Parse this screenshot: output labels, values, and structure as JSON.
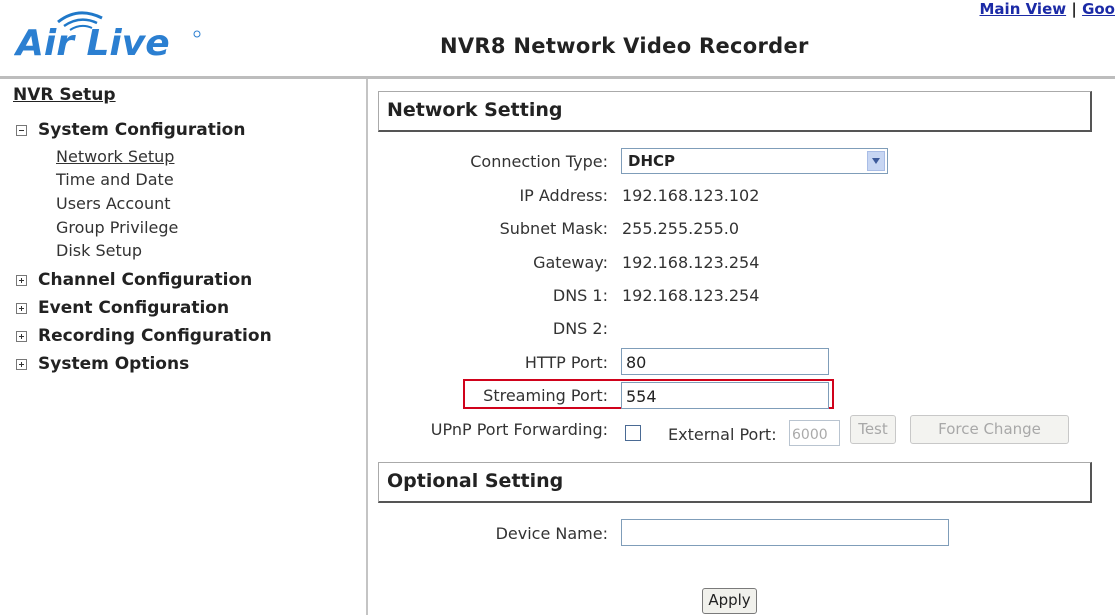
{
  "header": {
    "logo_text": "Air Live",
    "app_title": "NVR8 Network Video Recorder",
    "links": {
      "main_view": "Main View",
      "separator": "|",
      "partial": "Goo"
    }
  },
  "sidebar": {
    "title": "NVR Setup",
    "system_configuration": {
      "label": "System Configuration",
      "items": [
        "Network Setup",
        "Time and Date",
        "Users Account",
        "Group Privilege",
        "Disk Setup"
      ]
    },
    "sections": [
      "Channel Configuration",
      "Event Configuration",
      "Recording Configuration",
      "System Options"
    ]
  },
  "network": {
    "title": "Network Setting",
    "connection_type_label": "Connection Type:",
    "connection_type_value": "DHCP",
    "ip_label": "IP Address:",
    "ip_value": "192.168.123.102",
    "subnet_label": "Subnet Mask:",
    "subnet_value": "255.255.255.0",
    "gateway_label": "Gateway:",
    "gateway_value": "192.168.123.254",
    "dns1_label": "DNS 1:",
    "dns1_value": "192.168.123.254",
    "dns2_label": "DNS 2:",
    "dns2_value": "",
    "http_port_label": "HTTP Port:",
    "http_port_value": "80",
    "streaming_port_label": "Streaming Port:",
    "streaming_port_value": "554",
    "upnp_label": "UPnP Port Forwarding:",
    "upnp_checked": false,
    "external_port_label": "External Port:",
    "external_port_value": "6000",
    "test_label": "Test",
    "force_change_label": "Force Change"
  },
  "optional": {
    "title": "Optional Setting",
    "device_name_label": "Device Name:",
    "device_name_value": ""
  },
  "apply_label": "Apply",
  "colors": {
    "link": "#1b2aa6",
    "logo_blue": "#2b7fd1",
    "highlight": "#d0021b"
  }
}
